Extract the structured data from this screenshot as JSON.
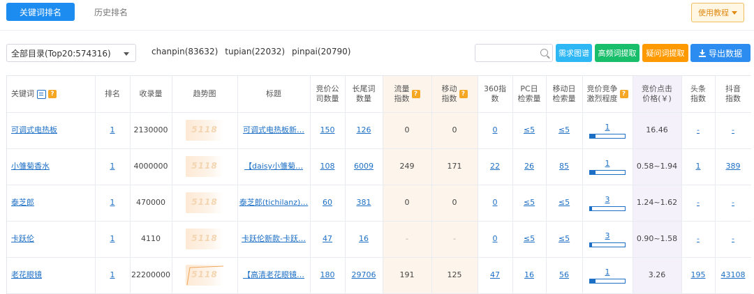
{
  "tabs": {
    "active": "关键词排名",
    "inactive": "历史排名"
  },
  "tutorial": {
    "label": "使用教程"
  },
  "filter": {
    "directory": "全部目录(Top20:574316)",
    "domains": [
      "chanpin(83632)",
      "tupian(22032)",
      "pinpai(20790)"
    ],
    "search_placeholder": ""
  },
  "actions": {
    "need_chart": "需求图谱",
    "high_freq": "高频词提取",
    "question": "疑问词提取",
    "export": "导出数据"
  },
  "colors": {
    "primary": "#1d8cf0",
    "link": "#1d6fc6",
    "badge": "#f5a623",
    "orange_shade": "#fdf5ec",
    "purple_shade": "#f5f1fb"
  },
  "table": {
    "headers": {
      "keyword": "关键词",
      "rank": "排名",
      "indexed": "收录量",
      "trend": "趋势图",
      "title": "标题",
      "bid_companies": [
        "竞价公",
        "司数量"
      ],
      "longtail": [
        "长尾词",
        "数量"
      ],
      "traffic": [
        "流量",
        "指数"
      ],
      "mobile": [
        "移动",
        "指数"
      ],
      "idx360": [
        "360指",
        "数"
      ],
      "pc_daily": [
        "PC日",
        "检索量"
      ],
      "mobile_daily": [
        "移动日",
        "检索量"
      ],
      "competition": [
        "竞价竞争",
        "激烈程度"
      ],
      "cpc": [
        "竞价点击",
        "价格(￥)"
      ],
      "toutiao": [
        "头条",
        "指数"
      ],
      "douyin": [
        "抖音",
        "指数"
      ]
    },
    "rows": [
      {
        "keyword": "可调式电热板",
        "rank": "1",
        "indexed": "2130000",
        "title": "可调式电热板新…",
        "bid": "150",
        "longtail": "126",
        "traffic": "0",
        "mobile": "0",
        "idx360": "0",
        "pc": "≤5",
        "mob": "≤5",
        "comp": "1",
        "comp_level": 0.15,
        "cpc": "16.46",
        "toutiao": "-",
        "douyin": "-",
        "trend_line": false
      },
      {
        "keyword": "小雏菊香水",
        "rank": "1",
        "indexed": "4000000",
        "title": "【daisy小雏菊…",
        "bid": "108",
        "longtail": "6009",
        "traffic": "249",
        "mobile": "171",
        "idx360": "22",
        "pc": "26",
        "mob": "85",
        "comp": "1",
        "comp_level": 0.15,
        "cpc": "0.58~1.94",
        "toutiao": "1",
        "douyin": "389",
        "trend_line": false
      },
      {
        "keyword": "泰芝郎",
        "rank": "1",
        "indexed": "470000",
        "title": "泰芝郎(tichilanz)…",
        "bid": "60",
        "longtail": "381",
        "traffic": "0",
        "mobile": "0",
        "idx360": "0",
        "pc": "≤5",
        "mob": "≤5",
        "comp": "3",
        "comp_level": 0.05,
        "cpc": "1.24~1.62",
        "toutiao": "-",
        "douyin": "-",
        "trend_line": false
      },
      {
        "keyword": "卡跃伦",
        "rank": "1",
        "indexed": "4110",
        "title": "卡跃伦新款-卡跃…",
        "bid": "47",
        "longtail": "16",
        "traffic": "-",
        "mobile": "-",
        "idx360": "0",
        "pc": "≤5",
        "mob": "≤5",
        "comp": "3",
        "comp_level": 0.05,
        "cpc": "0.90~1.58",
        "toutiao": "-",
        "douyin": "-",
        "trend_line": false
      },
      {
        "keyword": "老花眼镜",
        "rank": "1",
        "indexed": "22200000",
        "title": "【高清老花眼镜…",
        "bid": "180",
        "longtail": "29706",
        "traffic": "191",
        "mobile": "125",
        "idx360": "47",
        "pc": "16",
        "mob": "56",
        "comp": "1",
        "comp_level": 0.15,
        "cpc": "3.26",
        "toutiao": "195",
        "douyin": "43108",
        "trend_line": true
      }
    ],
    "watermark": "5118"
  }
}
